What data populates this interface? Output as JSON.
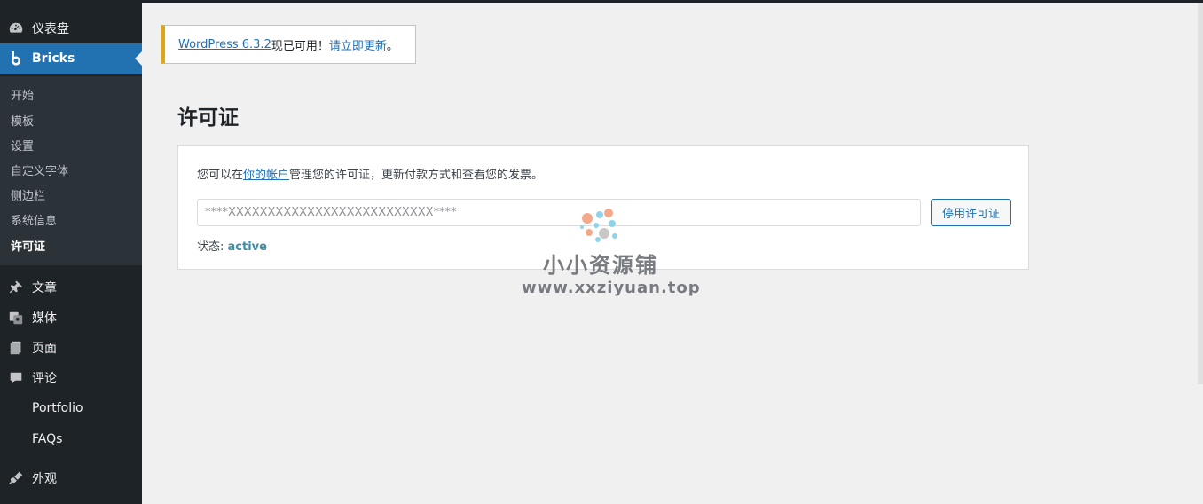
{
  "sidebar": {
    "dashboard": {
      "label": "仪表盘",
      "icon": "dashboard-icon"
    },
    "bricks": {
      "label": "Bricks",
      "icon": "bricks-logo-icon"
    },
    "submenu": [
      "开始",
      "模板",
      "设置",
      "自定义字体",
      "侧边栏",
      "系统信息",
      "许可证"
    ],
    "posts": {
      "label": "文章",
      "icon": "pushpin-icon"
    },
    "media": {
      "label": "媒体",
      "icon": "media-icon"
    },
    "pages": {
      "label": "页面",
      "icon": "page-icon"
    },
    "comments": {
      "label": "评论",
      "icon": "comment-icon"
    },
    "portfolio": {
      "label": "Portfolio"
    },
    "faqs": {
      "label": "FAQs"
    },
    "appearance": {
      "label": "外观",
      "icon": "brush-icon"
    }
  },
  "notice": {
    "link_version": "WordPress 6.3.2",
    "text_available": "现已可用！",
    "link_update": "请立即更新",
    "period": "。"
  },
  "page": {
    "title": "许可证",
    "desc_prefix": "您可以在",
    "desc_link": "你的帐户",
    "desc_suffix": "管理您的许可证，更新付款方式和查看您的发票。",
    "license_value": "****XXXXXXXXXXXXXXXXXXXXXXXXXX****",
    "deactivate_label": "停用许可证",
    "status_label": "状态:",
    "status_value": "active"
  },
  "watermark": {
    "name": "小小资源铺",
    "url": "www.xxziyuan.top"
  },
  "colors": {
    "sidebar_bg": "#1d2327",
    "submenu_bg": "#2c3338",
    "accent": "#2271b1",
    "notice_border": "#dba617",
    "status_active": "#3e8ea6"
  }
}
